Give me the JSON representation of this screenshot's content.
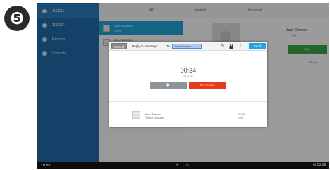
{
  "step_number": "❺",
  "sidebar": {
    "items": [
      {
        "label": "1111111",
        "icon": "phone-icon",
        "selected": true
      },
      {
        "label": "1111112",
        "icon": "voicemail-icon",
        "selected": false
      },
      {
        "label": "Recents",
        "icon": "recents-icon",
        "selected": false
      },
      {
        "label": "Contacts",
        "icon": "contacts-icon",
        "selected": false
      }
    ]
  },
  "tabs": [
    {
      "label": "All"
    },
    {
      "label": "Missed"
    },
    {
      "label": "Voicemail"
    }
  ],
  "list": {
    "rows": [
      {
        "name": "Jane Dawson",
        "sub": "Voice",
        "selected": true
      },
      {
        "name": "Jane Dawson",
        "sub": "",
        "selected": false
      }
    ]
  },
  "contact": {
    "name": "Jane Dawson",
    "ext": "8 (8)",
    "call_label": "Call",
    "history_label": "History"
  },
  "modal": {
    "cancel_label": "Cancel",
    "title": "Reply to message",
    "to_label": "To",
    "recipient": "Jane Dawson",
    "send_label": "Send",
    "timer": "00:34",
    "timer_sub": "max 1 min",
    "play_icon": "▶",
    "rerecord_label": "Re-record",
    "attachment": {
      "name": "Jane Dawson",
      "sub": "Original message",
      "time": "13:46",
      "date": "today"
    }
  },
  "bottom_bar": {
    "brand": "1111111",
    "back_icon": "↰",
    "home_icon": "⌂",
    "clock": "◂) 15:59"
  },
  "colors": {
    "sidebar": "#1f6aa8",
    "send": "#22a4df",
    "rerecord": "#e8391b",
    "call": "#3aa346"
  }
}
